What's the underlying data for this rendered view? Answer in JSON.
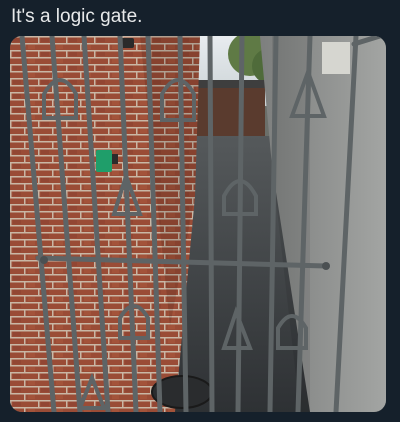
{
  "post": {
    "caption": "It's a logic gate.",
    "media": {
      "kind": "photo",
      "subject": "metal-gate-with-logic-gate-symbols",
      "colors": {
        "background": "#15202b",
        "text": "#e7e9ea",
        "brick": "#9a4c36",
        "render_wall": "#8e8f8d",
        "gate_metal": "#5e6466",
        "path": "#404448"
      }
    }
  }
}
